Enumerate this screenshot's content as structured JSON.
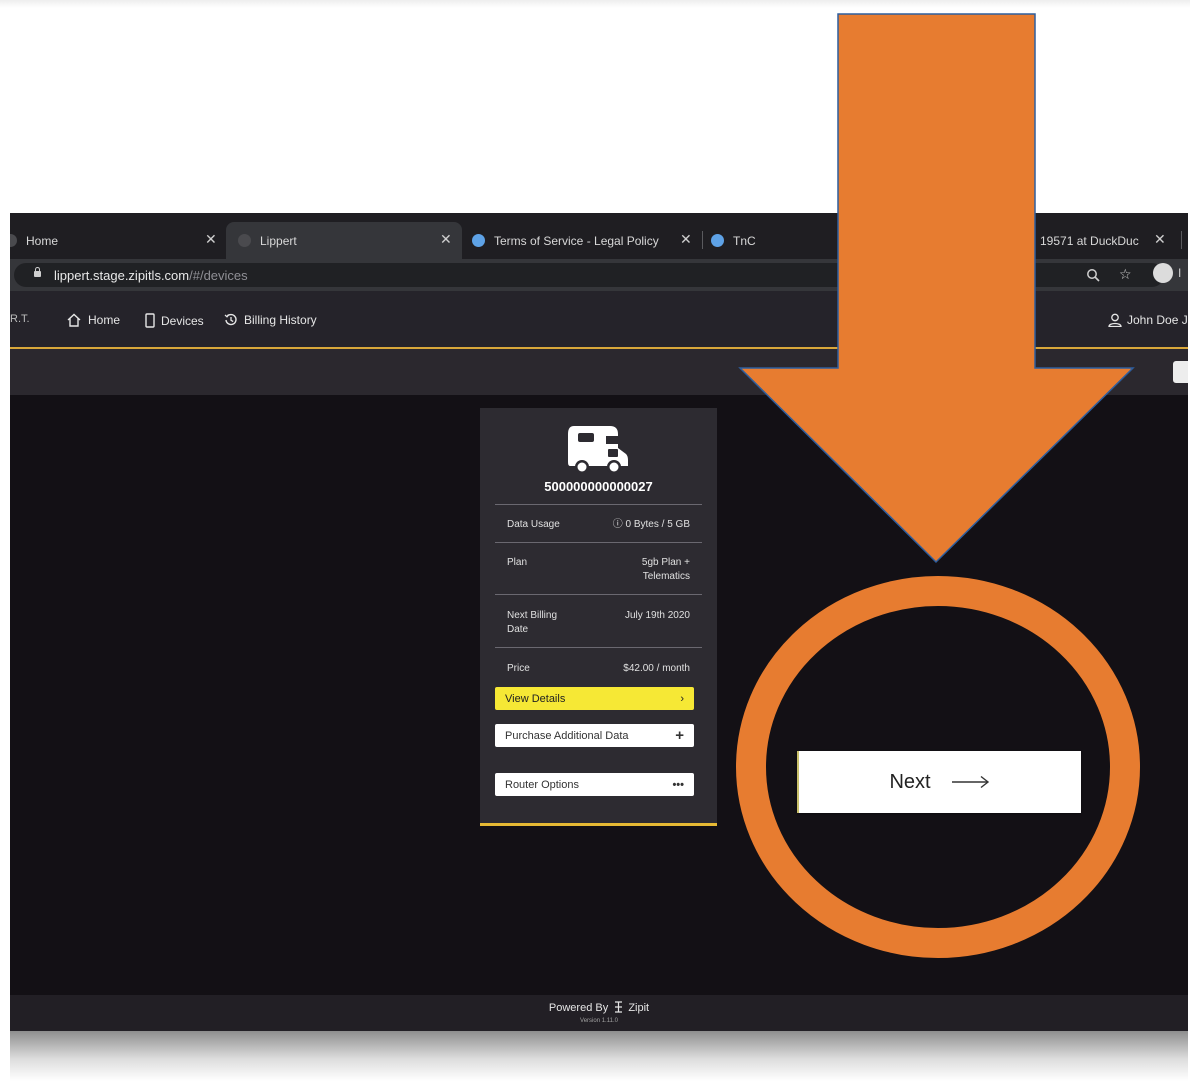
{
  "browser": {
    "tabs": [
      {
        "title": "Home"
      },
      {
        "title": "Lippert"
      },
      {
        "title": "Terms of Service - Legal Policy"
      },
      {
        "title": "TnC"
      },
      {
        "title": "19571 at DuckDuc"
      }
    ],
    "url_host": "lippert.stage.zipitls.com",
    "url_path": "/#/devices",
    "profile_initial": "I"
  },
  "nav": {
    "brand": "R.T.",
    "items": [
      {
        "label": "Home"
      },
      {
        "label": "Devices"
      },
      {
        "label": "Billing History"
      }
    ],
    "user": "John Doe Jr"
  },
  "device": {
    "id": "500000000000027",
    "rows": [
      {
        "label": "Data Usage",
        "value": "ⓘ 0 Bytes / 5 GB"
      },
      {
        "label": "Plan",
        "value": "5gb Plan +\nTelematics"
      },
      {
        "label": "Next Billing\nDate",
        "value": "July 19th 2020"
      },
      {
        "label": "Price",
        "value": "$42.00 / month"
      }
    ],
    "buttons": {
      "view_details": "View Details",
      "purchase": "Purchase Additional Data",
      "router": "Router Options"
    }
  },
  "footer": {
    "powered": "Powered By",
    "brand": "Zipit",
    "version": "Version 1.11.0"
  },
  "callout": {
    "next_label": "Next",
    "arrow_color": "#E77C30",
    "circle_color": "#E77C30"
  }
}
